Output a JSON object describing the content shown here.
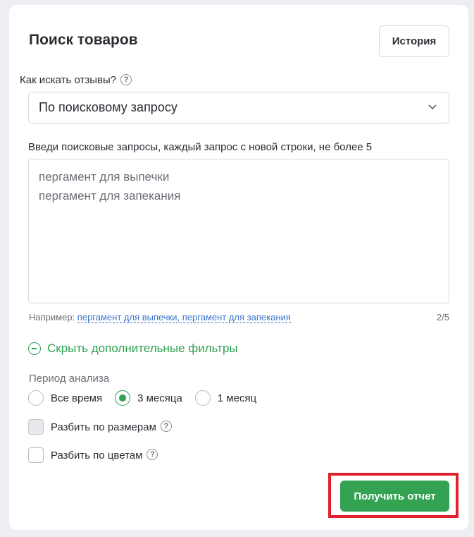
{
  "header": {
    "title": "Поиск товаров",
    "history_label": "История"
  },
  "search_mode": {
    "label": "Как искать отзывы?",
    "help": "?",
    "selected": "По поисковому запросу"
  },
  "queries": {
    "label": "Введи поисковые запросы, каждый запрос с новой строки, не более 5",
    "lines": [
      "пергамент для выпечки",
      "пергамент для запекания"
    ],
    "example_prefix": "Например:",
    "example_link": "пергамент для выпечки, пергамент для запекания",
    "counter": "2/5"
  },
  "filters": {
    "toggle_label": "Скрыть дополнительные фильтры",
    "period_label": "Период анализа",
    "period_options": [
      "Все время",
      "3 месяца",
      "1 месяц"
    ],
    "period_selected": "3 месяца",
    "split_sizes_label": "Разбить по размерам",
    "split_colors_label": "Разбить по цветам",
    "help": "?"
  },
  "actions": {
    "submit_label": "Получить отчет"
  },
  "colors": {
    "accent": "#34a253",
    "link": "#3b74c9",
    "highlight": "#e0202a"
  }
}
